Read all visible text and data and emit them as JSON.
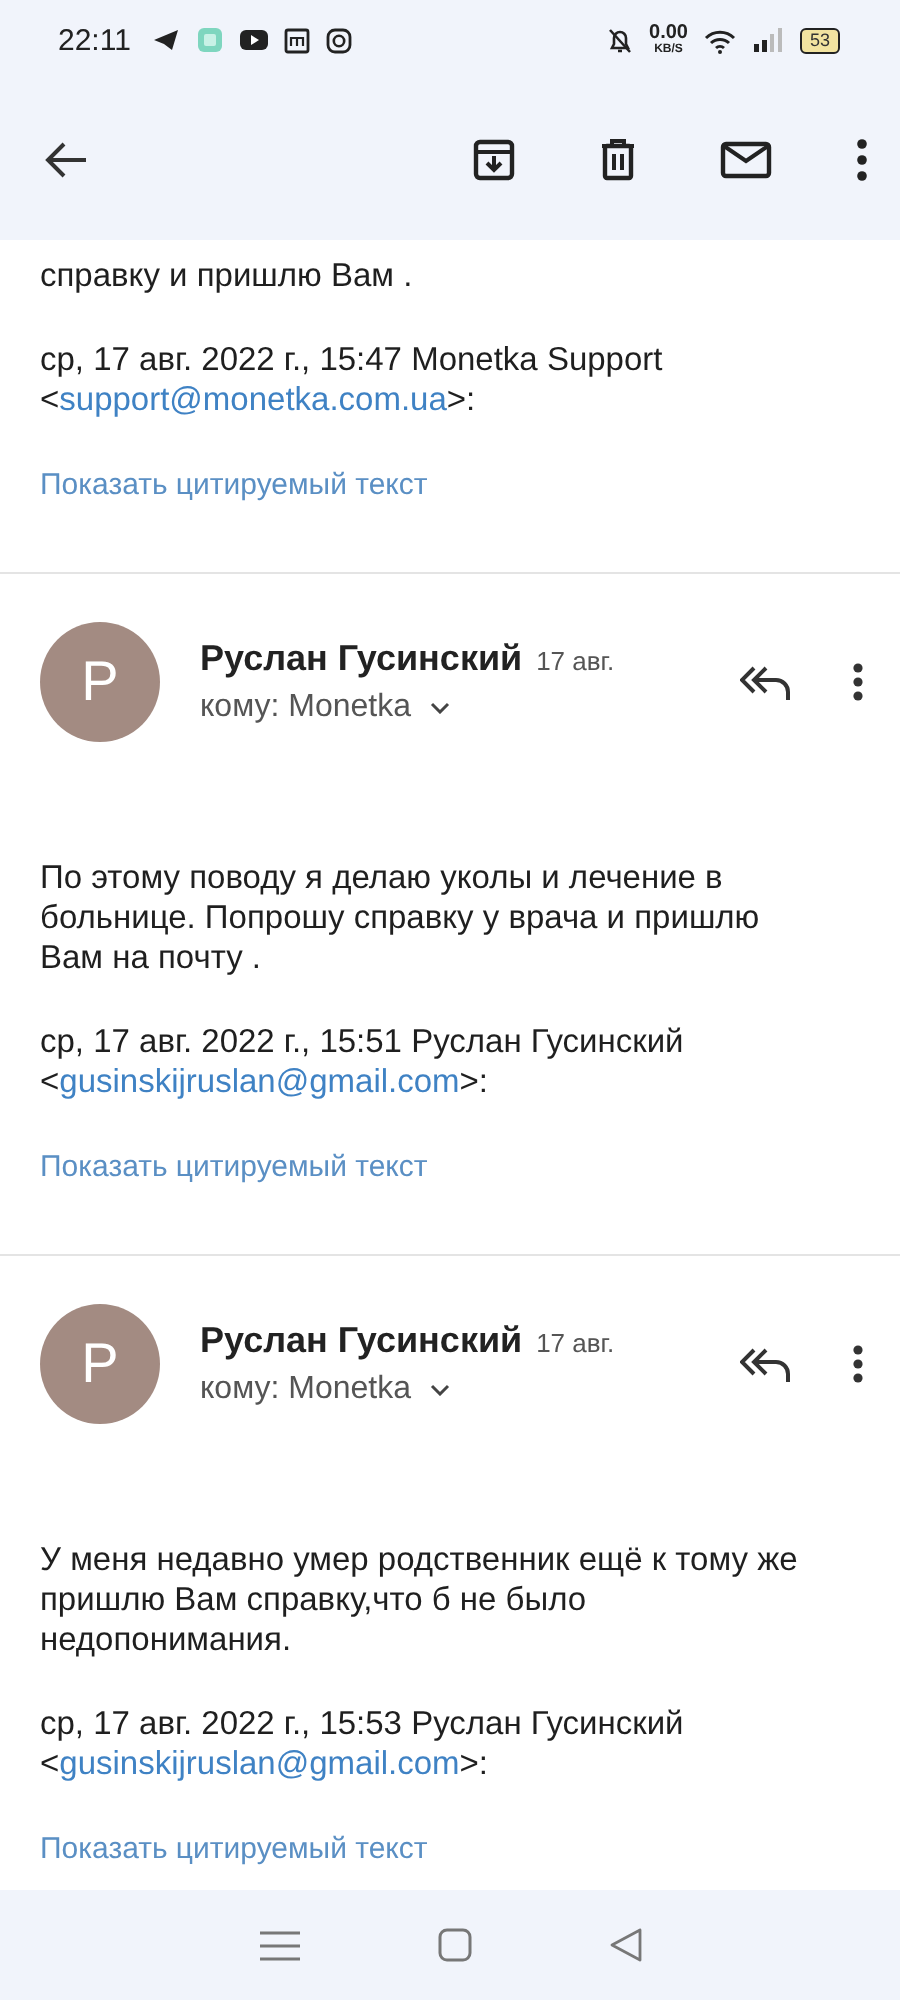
{
  "status_bar": {
    "time": "22:11",
    "data_speed": "0.00",
    "data_unit": "KB/S",
    "battery": "53"
  },
  "messages": [
    {
      "kind": "tail",
      "body": "справку и пришлю Вам .",
      "quote_header": "ср, 17 авг. 2022 г., 15:47 Monetka Support",
      "quote_open": "<",
      "quote_email": "support@monetka.com.ua",
      "quote_suffix": ">:",
      "show_quoted": "Показать цитируемый текст"
    },
    {
      "kind": "full",
      "avatar": "Р",
      "sender": "Руслан Гусинский",
      "date": "17 авг.",
      "to": "кому: Monetka",
      "body": "По этому поводу я делаю уколы и лечение в больнице. Попрошу справку у врача и пришлю Вам на почту .",
      "quote_header": "ср, 17 авг. 2022 г., 15:51 Руслан Гусинский",
      "quote_open": "<",
      "quote_email": "gusinskijruslan@gmail.com",
      "quote_suffix": ">:",
      "show_quoted": "Показать цитируемый текст"
    },
    {
      "kind": "full",
      "avatar": "Р",
      "sender": "Руслан Гусинский",
      "date": "17 авг.",
      "to": "кому: Monetka",
      "body": "У меня недавно умер родственник ещё к тому же пришлю Вам справку,что б не было недопонимания.",
      "quote_header": "ср, 17 авг. 2022 г., 15:53 Руслан Гусинский",
      "quote_open": "<",
      "quote_email": "gusinskijruslan@gmail.com",
      "quote_suffix": ">:",
      "show_quoted": "Показать цитируемый текст"
    }
  ]
}
